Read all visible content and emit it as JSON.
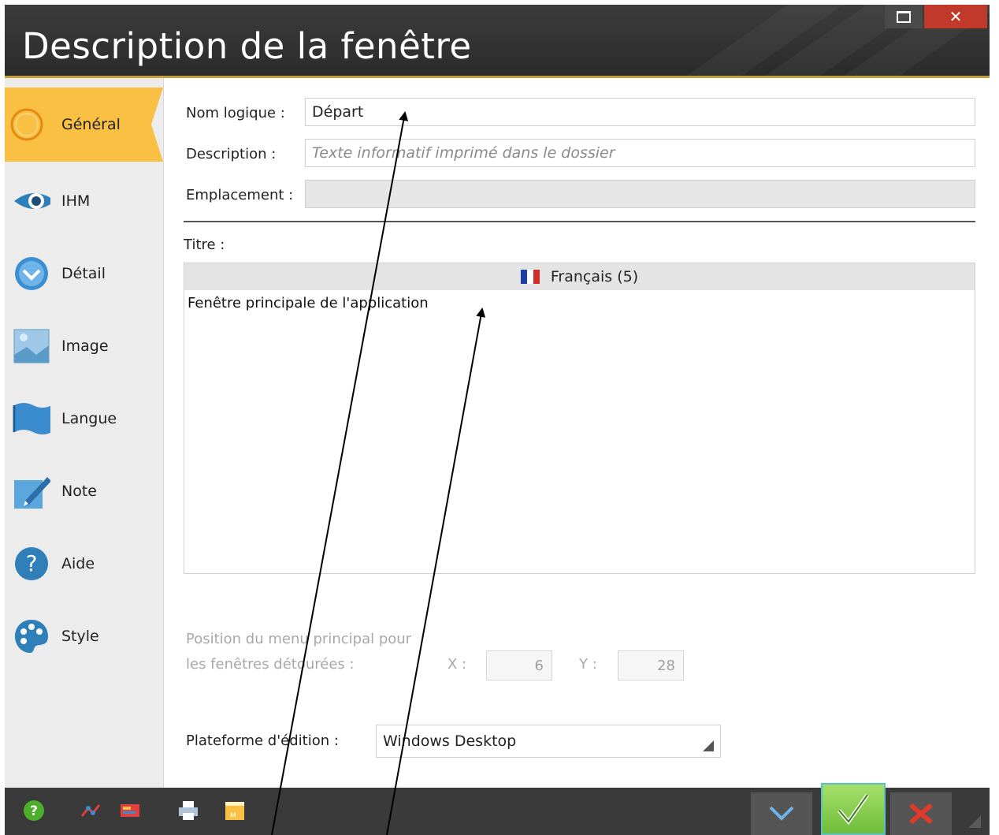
{
  "window": {
    "title": "Description de la fenêtre"
  },
  "sidebar": {
    "items": [
      {
        "label": "Général",
        "icon": "circle-icon",
        "active": true
      },
      {
        "label": "IHM",
        "icon": "eye-icon",
        "active": false
      },
      {
        "label": "Détail",
        "icon": "chevron-circle-icon",
        "active": false
      },
      {
        "label": "Image",
        "icon": "image-icon",
        "active": false
      },
      {
        "label": "Langue",
        "icon": "flag-icon",
        "active": false
      },
      {
        "label": "Note",
        "icon": "pencil-note-icon",
        "active": false
      },
      {
        "label": "Aide",
        "icon": "help-icon",
        "active": false
      },
      {
        "label": "Style",
        "icon": "palette-icon",
        "active": false
      }
    ]
  },
  "form": {
    "nom_logique_label": "Nom logique :",
    "nom_logique_value": "Départ",
    "description_label": "Description :",
    "description_placeholder": "Texte informatif imprimé dans le dossier",
    "emplacement_label": "Emplacement :",
    "emplacement_value": "",
    "titre_label": "Titre :",
    "titre_language": "Français (5)",
    "titre_value": "Fenêtre principale de l'application",
    "position_label_line1": "Position du menu principal pour",
    "position_label_line2": "les fenêtres détourées :",
    "x_label": "X :",
    "x_value": "6",
    "y_label": "Y :",
    "y_value": "28",
    "plateforme_label": "Plateforme d'édition :",
    "plateforme_value": "Windows Desktop"
  },
  "colors": {
    "accent": "#f9c044",
    "titlebar": "#2b2b2b",
    "close": "#c0392b",
    "ok": "#7cc843"
  }
}
